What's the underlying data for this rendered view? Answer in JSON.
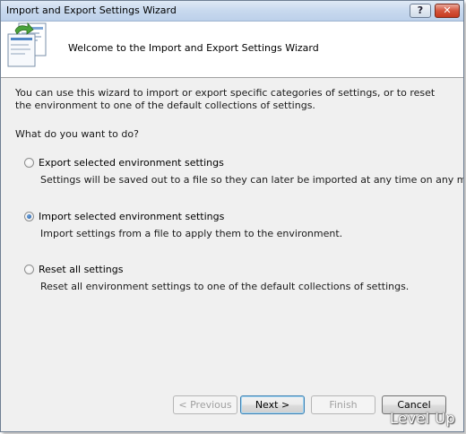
{
  "window": {
    "title": "Import and Export Settings Wizard",
    "help_label": "?",
    "close_label": "✕"
  },
  "header": {
    "title": "Welcome to the Import and Export Settings Wizard",
    "icon": "wizard-settings-icon"
  },
  "content": {
    "intro": "You can use this wizard to import or export specific categories of settings, or to reset the environment to one of the default collections of settings.",
    "question": "What do you want to do?",
    "options": [
      {
        "label": "Export selected environment settings",
        "description": "Settings will be saved out to a file so they can later be imported at any time on any machine.",
        "selected": false
      },
      {
        "label": "Import selected environment settings",
        "description": "Import settings from a file to apply them to the environment.",
        "selected": true
      },
      {
        "label": "Reset all settings",
        "description": "Reset all environment settings to one of the default collections of settings.",
        "selected": false
      }
    ]
  },
  "buttons": {
    "previous": "< Previous",
    "next": "Next >",
    "finish": "Finish",
    "cancel": "Cancel"
  },
  "watermark": "Level Up"
}
